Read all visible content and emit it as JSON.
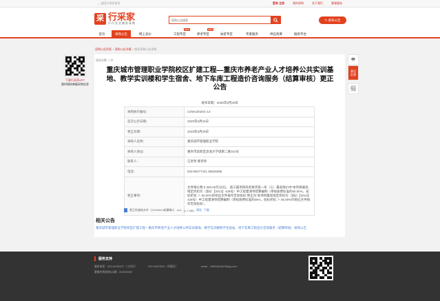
{
  "topbar": {
    "home_link": "返回行采家首页",
    "login": "登录",
    "register": "注册",
    "my_procurement": "我的采购",
    "about": "关于我们",
    "service": "客服服务"
  },
  "header": {
    "logo_mark": "采",
    "logo_text": "行采家",
    "logo_sub": "行行业业服务采购",
    "search_placeholder": "采购公告搜索",
    "publish_btn": "发布公告"
  },
  "nav": {
    "items": [
      {
        "label": "首页"
      },
      {
        "label": "采购公告"
      },
      {
        "label": "网上竞价"
      },
      {
        "label": "工程专区",
        "badge": "NEW"
      },
      {
        "label": "养老专区",
        "badge": "NEW"
      },
      {
        "label": "扶贫专区"
      },
      {
        "label": "专家服务"
      },
      {
        "label": "供应商库"
      },
      {
        "label": "融资平台"
      }
    ]
  },
  "breadcrumb": {
    "part1": "采购公告列表",
    "sep1": " > ",
    "part2": "采购公告详情",
    "sep2": " > ",
    "part3": "相关采购公告详情"
  },
  "article": {
    "views": "阅读次数: 7 次",
    "title": "重庆城市管理职业学院校区扩建工程—重庆市养老产业人才培养公共实训基地、教学实训楼和学生宿舍、地下车库工程造价咨询服务（结算审核）更正公告",
    "pubdate": "发布日期：2020年6月29日",
    "rows": [
      {
        "label": "采购执行编号：",
        "value": "CSWU2020C-13"
      },
      {
        "label": "首次公示日期：",
        "value": "2020年6月24日"
      },
      {
        "label": "更正日期：",
        "value": "2020年6月29日"
      },
      {
        "label": "采购人名称：",
        "value": "重庆城市管理职业学院"
      },
      {
        "label": "采购人地址：",
        "value": "重庆市高新区虎溪大学城南二路151号"
      },
      {
        "label": "联系人：",
        "value": "汪老师 黎老师"
      },
      {
        "label": "电话：",
        "value": "023-86277421 65626068"
      }
    ],
    "change_label": "更正事项：",
    "change_text": "文件限价费:¥ 300.00元/分包。 第三篇项目商务要求第一条（三）最高限价中“本项目最高限定折扣为（渝价【2013】428号）中工程量清单结算编制（审核收费标准的60.00%，投标折扣 ＞ 60.00%的响应文件按作无效投标”更正为“本项目最高限定折扣为（渝价【2013】428号）中工程量清单结算编制（审核收费标准的55%，投标折扣 ＞ 55.00%的响应文件按作无效投标”。",
    "attachment_name": "更正性磋商文件（20200624结算概2）.doc",
    "attachment_size": "(1.2 MB)",
    "preview": "预览",
    "download": "下载"
  },
  "related": {
    "heading": "相关公告",
    "text": "重庆城市管理职业学院校区扩建工程—重庆市养老产业人才培养公共实训基地、教学实训楼和学生宿舍、地下车库工程造价咨询服务（结算审核）采购公告"
  },
  "left_qr_caption": {
    "line1": "下载行采家APP",
    "line2": "随时随地掌握采购信息"
  },
  "side_tools": {
    "print": "🖶",
    "share_top": "意见",
    "share_bottom": "反馈",
    "top_label": "返回",
    "top_label2": "顶部"
  },
  "footer": {
    "heading": "服务支持",
    "phone1": "服务电话：023-63782227（工作日）",
    "phone2": "023-63237831（节假日）",
    "email": "email：19839464870@qq.com",
    "qq": "客服在线咨询QQ群：819940303"
  },
  "colors": {
    "brand": "#e2421f",
    "link": "#4a7fd6",
    "footer_bg": "#333333"
  }
}
